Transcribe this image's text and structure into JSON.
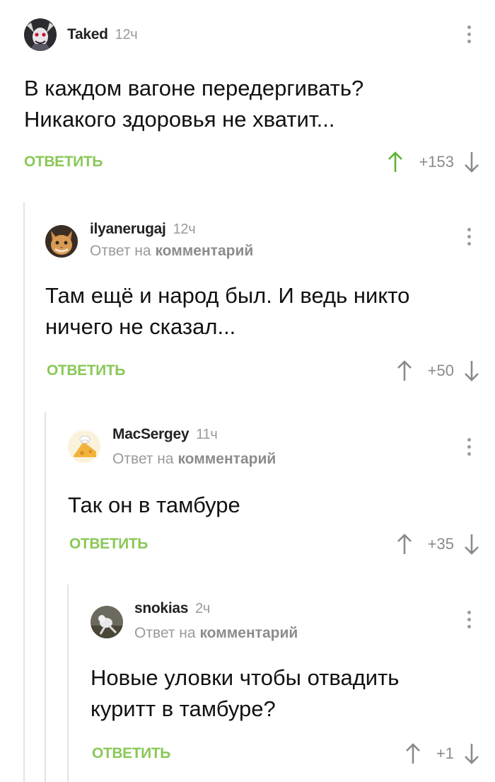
{
  "comments": [
    {
      "author": "Taked",
      "time": "12ч",
      "reply_to": null,
      "text_lines": [
        "В каждом вагоне передергивать?",
        "Никакого здоровья не хватит..."
      ],
      "reply_label": "ОТВЕТИТЬ",
      "score": "+153",
      "upvoted": true,
      "avatar_icon": "demon-avatar"
    },
    {
      "author": "ilyanerugaj",
      "time": "12ч",
      "reply_to": {
        "prefix": "Ответ на",
        "link": "комментарий"
      },
      "text_lines": [
        "Там ещё и народ был. И ведь никто",
        "ничего не сказал..."
      ],
      "reply_label": "ОТВЕТИТЬ",
      "score": "+50",
      "upvoted": false,
      "avatar_icon": "cat-avatar"
    },
    {
      "author": "MacSergey",
      "time": "11ч",
      "reply_to": {
        "prefix": "Ответ на",
        "link": "комментарий"
      },
      "text_lines": [
        "Так он в тамбуре"
      ],
      "reply_label": "ОТВЕТИТЬ",
      "score": "+35",
      "upvoted": false,
      "avatar_icon": "cheese-chef-avatar"
    },
    {
      "author": "snokias",
      "time": "2ч",
      "reply_to": {
        "prefix": "Ответ на",
        "link": "комментарий"
      },
      "text_lines": [
        "Новые уловки чтобы отвадить",
        "куритт в тамбуре?"
      ],
      "reply_label": "ОТВЕТИТЬ",
      "score": "+1",
      "upvoted": false,
      "avatar_icon": "photo-avatar"
    }
  ],
  "colors": {
    "accent_green": "#8ac858",
    "muted_gray": "#9a9a9a",
    "thread_line": "#e3e3e3"
  }
}
